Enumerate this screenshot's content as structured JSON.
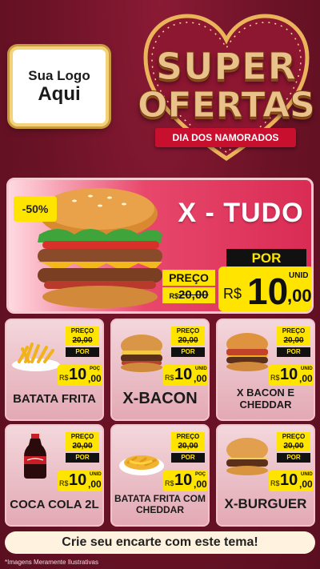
{
  "colors": {
    "background": "#6e1428",
    "accent": "#ffe400",
    "hero": "#d92c55"
  },
  "logo": {
    "line1": "Sua Logo",
    "line2": "Aqui"
  },
  "title": {
    "line1": "SUPER",
    "line2": "OFERTAS",
    "ribbon": "DIA DOS NAMORADOS"
  },
  "hero": {
    "name": "X - TUDO",
    "discount": "-50%",
    "price_label": "PREÇO",
    "old_price": "20,00",
    "old_prefix": "R$",
    "por_label": "POR",
    "currency": "R$",
    "price_int": "10",
    "price_dec": ",00",
    "unit": "UNID"
  },
  "products": [
    {
      "name": "BATATA FRITA",
      "price_label": "PREÇO",
      "old_price": "20,00",
      "por_label": "POR",
      "currency": "R$",
      "price_int": "10",
      "price_dec": ",00",
      "unit": "POÇ",
      "icon": "fries-icon"
    },
    {
      "name": "X-BACON",
      "price_label": "PREÇO",
      "old_price": "20,00",
      "por_label": "POR",
      "currency": "R$",
      "price_int": "10",
      "price_dec": ",00",
      "unit": "UNID",
      "icon": "burger-icon"
    },
    {
      "name": "X BACON E CHEDDAR",
      "price_label": "PREÇO",
      "old_price": "20,00",
      "por_label": "POR",
      "currency": "R$",
      "price_int": "10",
      "price_dec": ",00",
      "unit": "UNID",
      "icon": "burger-icon"
    },
    {
      "name": "COCA COLA 2L",
      "price_label": "PREÇO",
      "old_price": "20,00",
      "por_label": "POR",
      "currency": "R$",
      "price_int": "10",
      "price_dec": ",00",
      "unit": "UNID",
      "icon": "soda-bottle-icon"
    },
    {
      "name": "BATATA FRITA COM CHEDDAR",
      "price_label": "PREÇO",
      "old_price": "20,00",
      "por_label": "POR",
      "currency": "R$",
      "price_int": "10",
      "price_dec": ",00",
      "unit": "POÇ",
      "icon": "cheese-fries-icon"
    },
    {
      "name": "X-BURGUER",
      "price_label": "PREÇO",
      "old_price": "20,00",
      "por_label": "POR",
      "currency": "R$",
      "price_int": "10",
      "price_dec": ",00",
      "unit": "UNID",
      "icon": "burger-icon"
    }
  ],
  "cta": "Crie seu encarte com este tema!",
  "footnote": "*Imagens Meramente Ilustrativas"
}
